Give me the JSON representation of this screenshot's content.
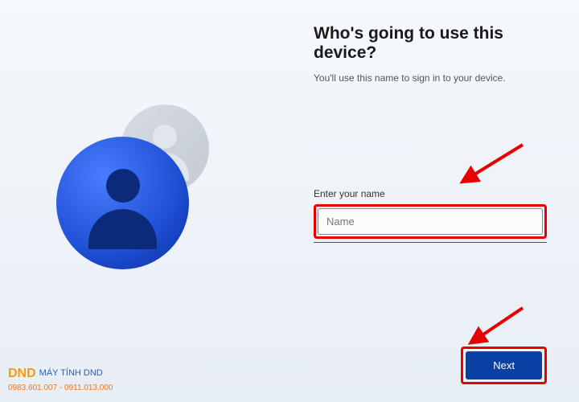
{
  "heading": "Who's going to use this device?",
  "subheading": "You'll use this name to sign in to your device.",
  "input": {
    "label": "Enter your name",
    "placeholder": "Name"
  },
  "buttons": {
    "next": "Next"
  },
  "watermark": {
    "logo": "DND",
    "brand": "MÁY TÍNH DND",
    "phone": "0983.601.007 - 0911.013.000"
  },
  "icons": {
    "avatar_front": "user-avatar-blue",
    "avatar_back": "user-avatar-gray"
  },
  "annotations": {
    "highlight_color": "#e60000"
  }
}
